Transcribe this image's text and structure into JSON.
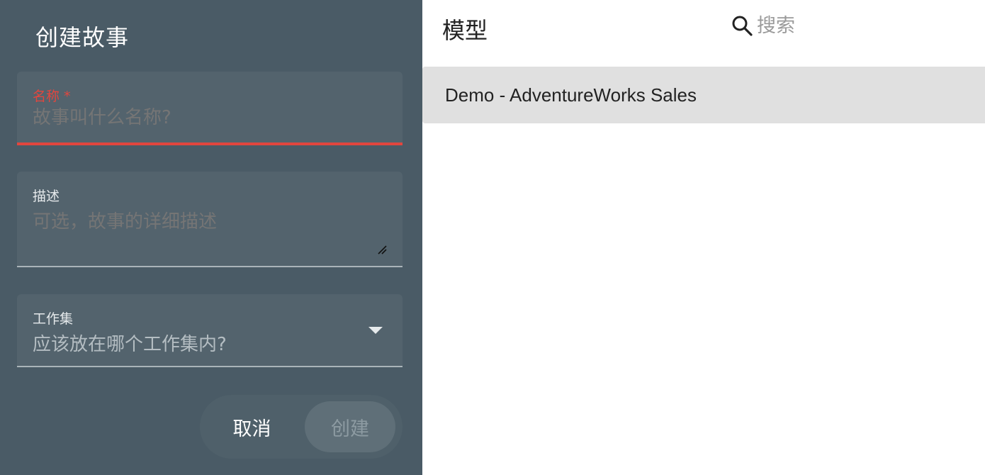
{
  "dialog": {
    "title": "创建故事",
    "name_field": {
      "label": "名称 *",
      "placeholder": "故事叫什么名称?",
      "value": ""
    },
    "description_field": {
      "label": "描述",
      "placeholder": "可选，故事的详细描述",
      "value": ""
    },
    "workspace_field": {
      "label": "工作集",
      "placeholder": "应该放在哪个工作集内?",
      "selected": ""
    },
    "actions": {
      "cancel_label": "取消",
      "create_label": "创建"
    }
  },
  "models_panel": {
    "title": "模型",
    "search": {
      "placeholder": "搜索",
      "icon": "search-icon"
    },
    "items": [
      {
        "label": "Demo - AdventureWorks Sales"
      }
    ]
  },
  "colors": {
    "left_panel_bg": "#4a5b66",
    "field_bg": "#53636d",
    "error": "#e2463e",
    "selected_item_bg": "#e0e0e0"
  }
}
